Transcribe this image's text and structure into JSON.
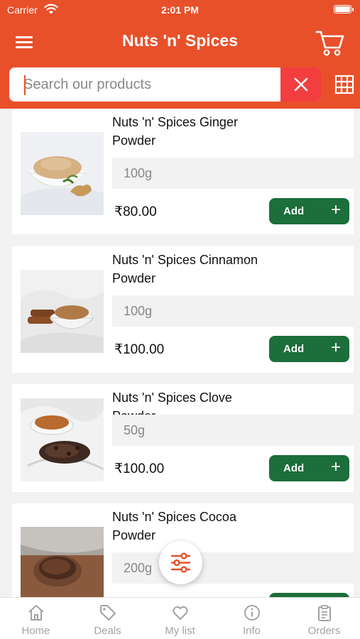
{
  "status_bar": {
    "carrier": "Carrier",
    "time": "2:01 PM"
  },
  "header": {
    "title": "Nuts 'n' Spices"
  },
  "search": {
    "placeholder": "Search our products",
    "value": ""
  },
  "products": [
    {
      "name": "Nuts 'n' Spices Ginger Powder",
      "variant": "100g",
      "price": "₹80.00",
      "add_label": "Add",
      "add_icon": "+"
    },
    {
      "name": "Nuts 'n' Spices Cinnamon Powder",
      "variant": "100g",
      "price": "₹100.00",
      "add_label": "Add",
      "add_icon": "+"
    },
    {
      "name": "Nuts 'n' Spices Clove Powder",
      "variant": "50g",
      "price": "₹100.00",
      "add_label": "Add",
      "add_icon": "+"
    },
    {
      "name": "Nuts 'n' Spices Cocoa Powder",
      "variant": "200g",
      "price": "",
      "add_label": "",
      "add_icon": ""
    }
  ],
  "bottom_nav": {
    "items": [
      {
        "label": "Home",
        "icon": "home-icon"
      },
      {
        "label": "Deals",
        "icon": "tag-icon"
      },
      {
        "label": "My list",
        "icon": "heart-icon"
      },
      {
        "label": "Info",
        "icon": "info-icon"
      },
      {
        "label": "Orders",
        "icon": "clipboard-icon"
      }
    ]
  },
  "colors": {
    "primary": "#e8502a",
    "add_button": "#1c6e3a",
    "clear_button": "#f23e3e",
    "nav_inactive": "#a3a3a3"
  }
}
